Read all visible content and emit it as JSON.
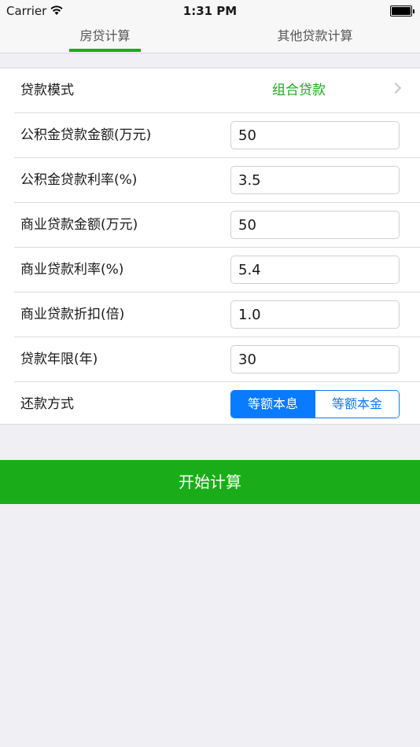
{
  "status_bar": {
    "carrier": "Carrier",
    "time": "1:31 PM"
  },
  "tabs": [
    {
      "label": "房贷计算",
      "active": true
    },
    {
      "label": "其他贷款计算",
      "active": false
    }
  ],
  "form": {
    "loan_mode": {
      "label": "贷款模式",
      "value": "组合贷款"
    },
    "fund_amount": {
      "label": "公积金贷款金额(万元)",
      "value": "50"
    },
    "fund_rate": {
      "label": "公积金贷款利率(%)",
      "value": "3.5"
    },
    "commercial_amount": {
      "label": "商业贷款金额(万元)",
      "value": "50"
    },
    "commercial_rate": {
      "label": "商业贷款利率(%)",
      "value": "5.4"
    },
    "commercial_discount": {
      "label": "商业贷款折扣(倍)",
      "value": "1.0"
    },
    "loan_years": {
      "label": "贷款年限(年)",
      "value": "30"
    },
    "repayment": {
      "label": "还款方式",
      "options": [
        "等额本息",
        "等额本金"
      ],
      "selected": "等额本息"
    }
  },
  "actions": {
    "calculate_label": "开始计算"
  },
  "colors": {
    "accent_green": "#1aad19",
    "segment_blue": "#0a7aff",
    "background": "#efeff4"
  }
}
